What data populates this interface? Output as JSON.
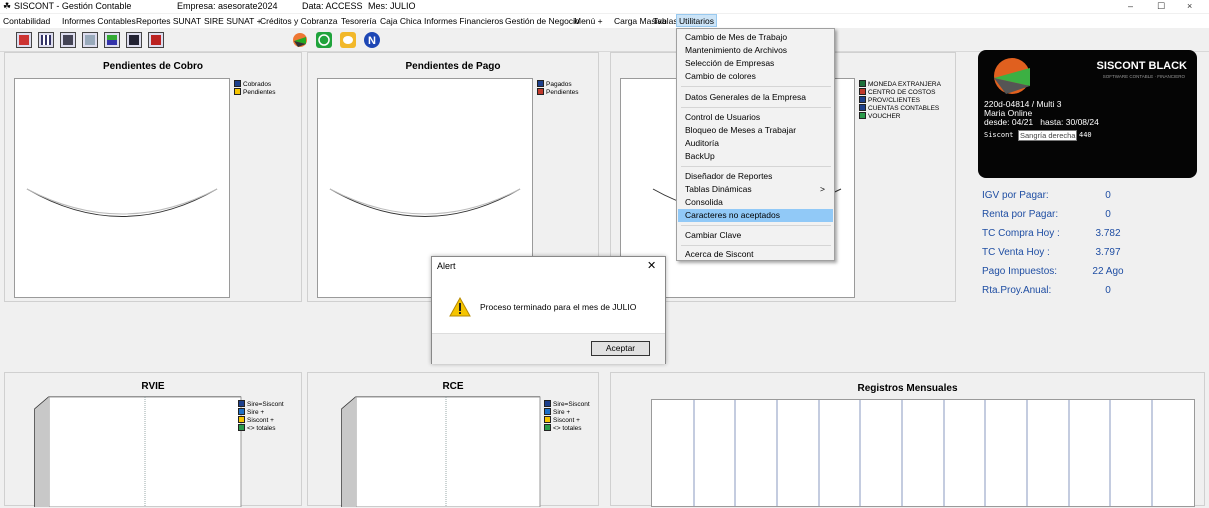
{
  "titlebar": {
    "app": "SISCONT - Gestión Contable",
    "empresa": "Empresa: asesorate2024",
    "data": "Data: ACCESS",
    "mes": "Mes: JULIO",
    "minimize": "–",
    "maximize": "☐",
    "close": "×"
  },
  "menubar": [
    "Contabilidad",
    "Informes Contables",
    "Reportes SUNAT",
    "SIRE SUNAT +",
    "Créditos y Cobranza",
    "Tesorería",
    "Caja Chica",
    "Informes Financieros",
    "Gestión de Negocio",
    "Menú +",
    "Carga Masiva",
    "Tablas",
    "Utilitarios"
  ],
  "toolbar_icons": [
    "calendar-icon",
    "grid-icon",
    "calculator-icon",
    "window-icon",
    "chart-icon",
    "line-chart-icon",
    "book-icon"
  ],
  "colors": {
    "accent": "#1f4ea3",
    "highlight": "#91c9f7",
    "warning": "#f5c400"
  },
  "utilitarios_menu": [
    "Cambio de Mes de Trabajo",
    "Mantenimiento de Archivos",
    "Selección de Empresas",
    "Cambio de colores",
    "Datos Generales de la Empresa",
    "Control de Usuarios",
    "Bloqueo de Meses a Trabajar",
    "Auditoría",
    "BackUp",
    "Diseñador de Reportes",
    "Tablas Dinámicas",
    "Consolida",
    "Caracteres no aceptados",
    "Cambiar Clave",
    "Acerca de Siscont"
  ],
  "submenu_arrow": ">",
  "panels": {
    "cobro": {
      "title": "Pendientes de Cobro",
      "legend": [
        "Cobrados",
        "Pendientes"
      ]
    },
    "pago": {
      "title": "Pendientes de Pago",
      "legend": [
        "Pagados",
        "Pendientes"
      ]
    },
    "third": {
      "legend": [
        "MONEDA EXTRANJERA",
        "CENTRO DE COSTOS",
        "PROV/CLIENTES",
        "CUENTAS CONTABLES",
        "VOUCHER"
      ]
    },
    "rvie": {
      "title": "RVIE",
      "legend": [
        "Sire=Siscont",
        "Sire +",
        "Siscont +",
        "<> totales"
      ]
    },
    "rce": {
      "title": "RCE",
      "legend": [
        "Sire=Siscont",
        "Sire +",
        "Siscont +",
        "<> totales"
      ]
    },
    "registros": {
      "title": "Registros Mensuales"
    }
  },
  "card": {
    "brand": "SISCONT BLACK",
    "tagline": "SOFTWARE CONTABLE · FINANCIERO",
    "license": "220d-04814 / Multi 3",
    "mode": "Maria Online",
    "desde": "desde: 04/21",
    "hasta": "hasta: 30/08/24",
    "label": "Siscont",
    "tooltip": "Sangría derecha",
    "code": "440"
  },
  "info": [
    {
      "label": "IGV por Pagar:",
      "value": "0"
    },
    {
      "label": "Renta por Pagar:",
      "value": "0"
    },
    {
      "label": "TC Compra Hoy :",
      "value": "3.782"
    },
    {
      "label": "TC Venta  Hoy :",
      "value": "3.797"
    },
    {
      "label": "Pago Impuestos:",
      "value": "22 Ago"
    },
    {
      "label": "Rta.Proy.Anual:",
      "value": "0"
    }
  ],
  "alert": {
    "title": "Alert",
    "close": "✕",
    "message": "Proceso terminado para el mes de JULIO",
    "button": "Aceptar"
  }
}
